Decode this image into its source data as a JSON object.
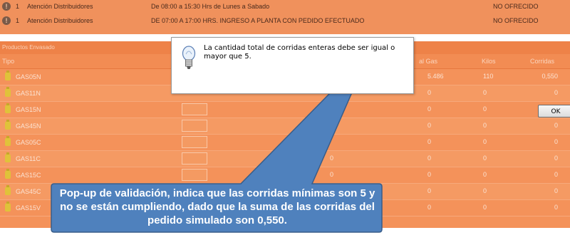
{
  "top_rows": [
    {
      "icon": "info-icon",
      "num": "1",
      "label": "Atención Distribuidores",
      "schedule": "De 08:00 a 15:30 Hrs de Lunes a Sabado",
      "status": "NO OFRECIDO"
    },
    {
      "icon": "info-icon",
      "num": "1",
      "label": "Atención Distribuidores",
      "schedule": "DE 07:00 A 17:00 HRS. INGRESO A PLANTA CON PEDIDO EFECTUADO",
      "status": "NO OFRECIDO"
    }
  ],
  "products": {
    "title": "Productos Envasado",
    "headers": {
      "tipo": "Tipo",
      "gas": "al Gas",
      "kilos": "Kilos",
      "corridas": "Corridas"
    },
    "rows": [
      {
        "name": "GAS05N",
        "gas": "5.486",
        "kilos": "110",
        "corridas": "0,550",
        "extra": ""
      },
      {
        "name": "GAS11N",
        "gas": "0",
        "kilos": "0",
        "corridas": "0",
        "extra": ""
      },
      {
        "name": "GAS15N",
        "gas": "0",
        "kilos": "0",
        "corridas": "0",
        "extra": ""
      },
      {
        "name": "GAS45N",
        "gas": "0",
        "kilos": "0",
        "corridas": "0",
        "extra": ""
      },
      {
        "name": "GAS05C",
        "gas": "0",
        "kilos": "0",
        "corridas": "0",
        "extra": ""
      },
      {
        "name": "GAS11C",
        "gas": "0",
        "kilos": "0",
        "corridas": "0",
        "extra": "0"
      },
      {
        "name": "GAS15C",
        "gas": "0",
        "kilos": "0",
        "corridas": "0",
        "extra": "0"
      },
      {
        "name": "GAS45C",
        "gas": "0",
        "kilos": "0",
        "corridas": "0",
        "extra": ""
      },
      {
        "name": "GAS15V",
        "gas": "0",
        "kilos": "0",
        "corridas": "0",
        "extra": ""
      }
    ]
  },
  "dialog": {
    "icon": "lightbulb-icon",
    "message": "La cantidad total de corridas enteras debe ser igual o mayor que 5.",
    "ok_label": "OK"
  },
  "callout": {
    "text": "Pop-up de validación, indica que las corridas mínimas son 5 y no se están cumpliendo, dado que la suma de las corridas del pedido simulado son 0,550."
  },
  "colors": {
    "panel": "#f0915c",
    "callout_fill": "#4f81bd",
    "callout_border": "#385d8a"
  }
}
